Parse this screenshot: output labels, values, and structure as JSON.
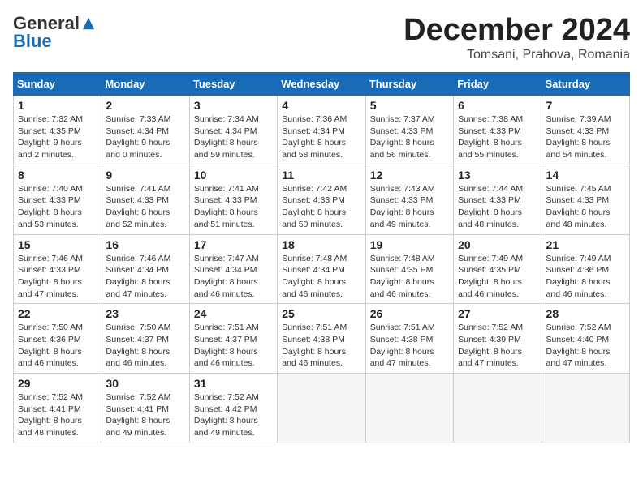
{
  "header": {
    "logo_general": "General",
    "logo_blue": "Blue",
    "month": "December 2024",
    "location": "Tomsani, Prahova, Romania"
  },
  "weekdays": [
    "Sunday",
    "Monday",
    "Tuesday",
    "Wednesday",
    "Thursday",
    "Friday",
    "Saturday"
  ],
  "weeks": [
    [
      {
        "day": 1,
        "sunrise": "7:32 AM",
        "sunset": "4:35 PM",
        "daylight": "9 hours and 2 minutes."
      },
      {
        "day": 2,
        "sunrise": "7:33 AM",
        "sunset": "4:34 PM",
        "daylight": "9 hours and 0 minutes."
      },
      {
        "day": 3,
        "sunrise": "7:34 AM",
        "sunset": "4:34 PM",
        "daylight": "8 hours and 59 minutes."
      },
      {
        "day": 4,
        "sunrise": "7:36 AM",
        "sunset": "4:34 PM",
        "daylight": "8 hours and 58 minutes."
      },
      {
        "day": 5,
        "sunrise": "7:37 AM",
        "sunset": "4:33 PM",
        "daylight": "8 hours and 56 minutes."
      },
      {
        "day": 6,
        "sunrise": "7:38 AM",
        "sunset": "4:33 PM",
        "daylight": "8 hours and 55 minutes."
      },
      {
        "day": 7,
        "sunrise": "7:39 AM",
        "sunset": "4:33 PM",
        "daylight": "8 hours and 54 minutes."
      }
    ],
    [
      {
        "day": 8,
        "sunrise": "7:40 AM",
        "sunset": "4:33 PM",
        "daylight": "8 hours and 53 minutes."
      },
      {
        "day": 9,
        "sunrise": "7:41 AM",
        "sunset": "4:33 PM",
        "daylight": "8 hours and 52 minutes."
      },
      {
        "day": 10,
        "sunrise": "7:41 AM",
        "sunset": "4:33 PM",
        "daylight": "8 hours and 51 minutes."
      },
      {
        "day": 11,
        "sunrise": "7:42 AM",
        "sunset": "4:33 PM",
        "daylight": "8 hours and 50 minutes."
      },
      {
        "day": 12,
        "sunrise": "7:43 AM",
        "sunset": "4:33 PM",
        "daylight": "8 hours and 49 minutes."
      },
      {
        "day": 13,
        "sunrise": "7:44 AM",
        "sunset": "4:33 PM",
        "daylight": "8 hours and 48 minutes."
      },
      {
        "day": 14,
        "sunrise": "7:45 AM",
        "sunset": "4:33 PM",
        "daylight": "8 hours and 48 minutes."
      }
    ],
    [
      {
        "day": 15,
        "sunrise": "7:46 AM",
        "sunset": "4:33 PM",
        "daylight": "8 hours and 47 minutes."
      },
      {
        "day": 16,
        "sunrise": "7:46 AM",
        "sunset": "4:34 PM",
        "daylight": "8 hours and 47 minutes."
      },
      {
        "day": 17,
        "sunrise": "7:47 AM",
        "sunset": "4:34 PM",
        "daylight": "8 hours and 46 minutes."
      },
      {
        "day": 18,
        "sunrise": "7:48 AM",
        "sunset": "4:34 PM",
        "daylight": "8 hours and 46 minutes."
      },
      {
        "day": 19,
        "sunrise": "7:48 AM",
        "sunset": "4:35 PM",
        "daylight": "8 hours and 46 minutes."
      },
      {
        "day": 20,
        "sunrise": "7:49 AM",
        "sunset": "4:35 PM",
        "daylight": "8 hours and 46 minutes."
      },
      {
        "day": 21,
        "sunrise": "7:49 AM",
        "sunset": "4:36 PM",
        "daylight": "8 hours and 46 minutes."
      }
    ],
    [
      {
        "day": 22,
        "sunrise": "7:50 AM",
        "sunset": "4:36 PM",
        "daylight": "8 hours and 46 minutes."
      },
      {
        "day": 23,
        "sunrise": "7:50 AM",
        "sunset": "4:37 PM",
        "daylight": "8 hours and 46 minutes."
      },
      {
        "day": 24,
        "sunrise": "7:51 AM",
        "sunset": "4:37 PM",
        "daylight": "8 hours and 46 minutes."
      },
      {
        "day": 25,
        "sunrise": "7:51 AM",
        "sunset": "4:38 PM",
        "daylight": "8 hours and 46 minutes."
      },
      {
        "day": 26,
        "sunrise": "7:51 AM",
        "sunset": "4:38 PM",
        "daylight": "8 hours and 47 minutes."
      },
      {
        "day": 27,
        "sunrise": "7:52 AM",
        "sunset": "4:39 PM",
        "daylight": "8 hours and 47 minutes."
      },
      {
        "day": 28,
        "sunrise": "7:52 AM",
        "sunset": "4:40 PM",
        "daylight": "8 hours and 47 minutes."
      }
    ],
    [
      {
        "day": 29,
        "sunrise": "7:52 AM",
        "sunset": "4:41 PM",
        "daylight": "8 hours and 48 minutes."
      },
      {
        "day": 30,
        "sunrise": "7:52 AM",
        "sunset": "4:41 PM",
        "daylight": "8 hours and 49 minutes."
      },
      {
        "day": 31,
        "sunrise": "7:52 AM",
        "sunset": "4:42 PM",
        "daylight": "8 hours and 49 minutes."
      },
      null,
      null,
      null,
      null
    ]
  ]
}
